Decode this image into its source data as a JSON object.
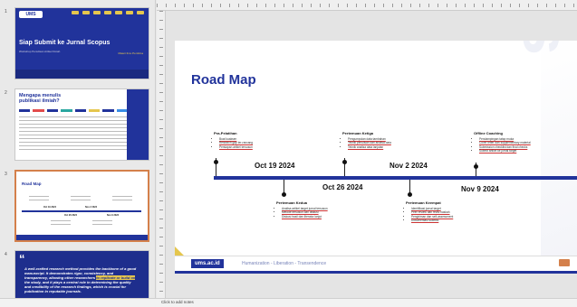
{
  "thumbnails": [
    {
      "number": "1",
      "title": "Siap Submit ke Jurnal Scopus",
      "logo": "UMS",
      "subtitle": "Workshop Penulisan Artikel Ilmiah",
      "right_label": "Materi Ilmu Pembina"
    },
    {
      "number": "2",
      "title": "Mengapa menulis publikasi ilmiah?"
    },
    {
      "number": "3",
      "title": "Road Map",
      "dates": [
        "Oct 19 2024",
        "Oct 26 2024",
        "Nov 2 2024",
        "Nov 9 2024"
      ]
    },
    {
      "number": "4",
      "quote_mark": "“",
      "quote_before": "A well-crafted research method provides the backbone of a good manuscript. It demonstrates rigor, consistency, and transparency, allowing other researchers ",
      "quote_highlight": "to replicate or build on",
      "quote_after": " the study, and it plays a central role in determining the quality and credibility of the research findings, which is crucial for publication in reputable journals."
    }
  ],
  "slide": {
    "title": "Road Map",
    "watermark": "ums",
    "milestones": [
      {
        "title": "Pra-Pelatihan",
        "date": "Oct 19 2024",
        "items": [
          "Buat kuaksen",
          "Research gap ter-rancang",
          "Persiapan artikel tersusun"
        ]
      },
      {
        "title": "Pertemuan Kedua",
        "date": "Oct 26 2024",
        "items": [
          "Analisa artikel target jurnal tersusun",
          "Metode tersusun dan diskusi",
          "Diskusi hasil dan literatur lanjut"
        ]
      },
      {
        "title": "Pertemuan Ketiga",
        "date": "Nov 2 2024",
        "items": [
          "Pengumpulan data tambahan",
          "Teknik penulisan dan analisa data",
          "Teknik analisa data lanjutan"
        ]
      },
      {
        "title": "Pertemuan Keempat",
        "date": "Nov 9 2024",
        "items": [
          "Identifikasi jurnal target",
          "Peer review dan revisi naskah",
          "Pengiriman dan self-assessment",
          "Dokumentasi submisi"
        ]
      },
      {
        "title": "Offline Coaching",
        "date": "",
        "items": [
          "Pendampingan tatap muka",
          "Cover letter dan supplementary material",
          "Submission checklist dan final checks",
          "Submit artikel ke jurnal target"
        ]
      }
    ],
    "footer": {
      "website": "ums.ac.id",
      "tagline": "Humanization - Liberation - Transendence"
    }
  },
  "status": {
    "notes_hint": "Click to add notes"
  },
  "colors": {
    "brand": "#21339b",
    "accent": "#e5c64d",
    "selection": "#d4804b"
  }
}
